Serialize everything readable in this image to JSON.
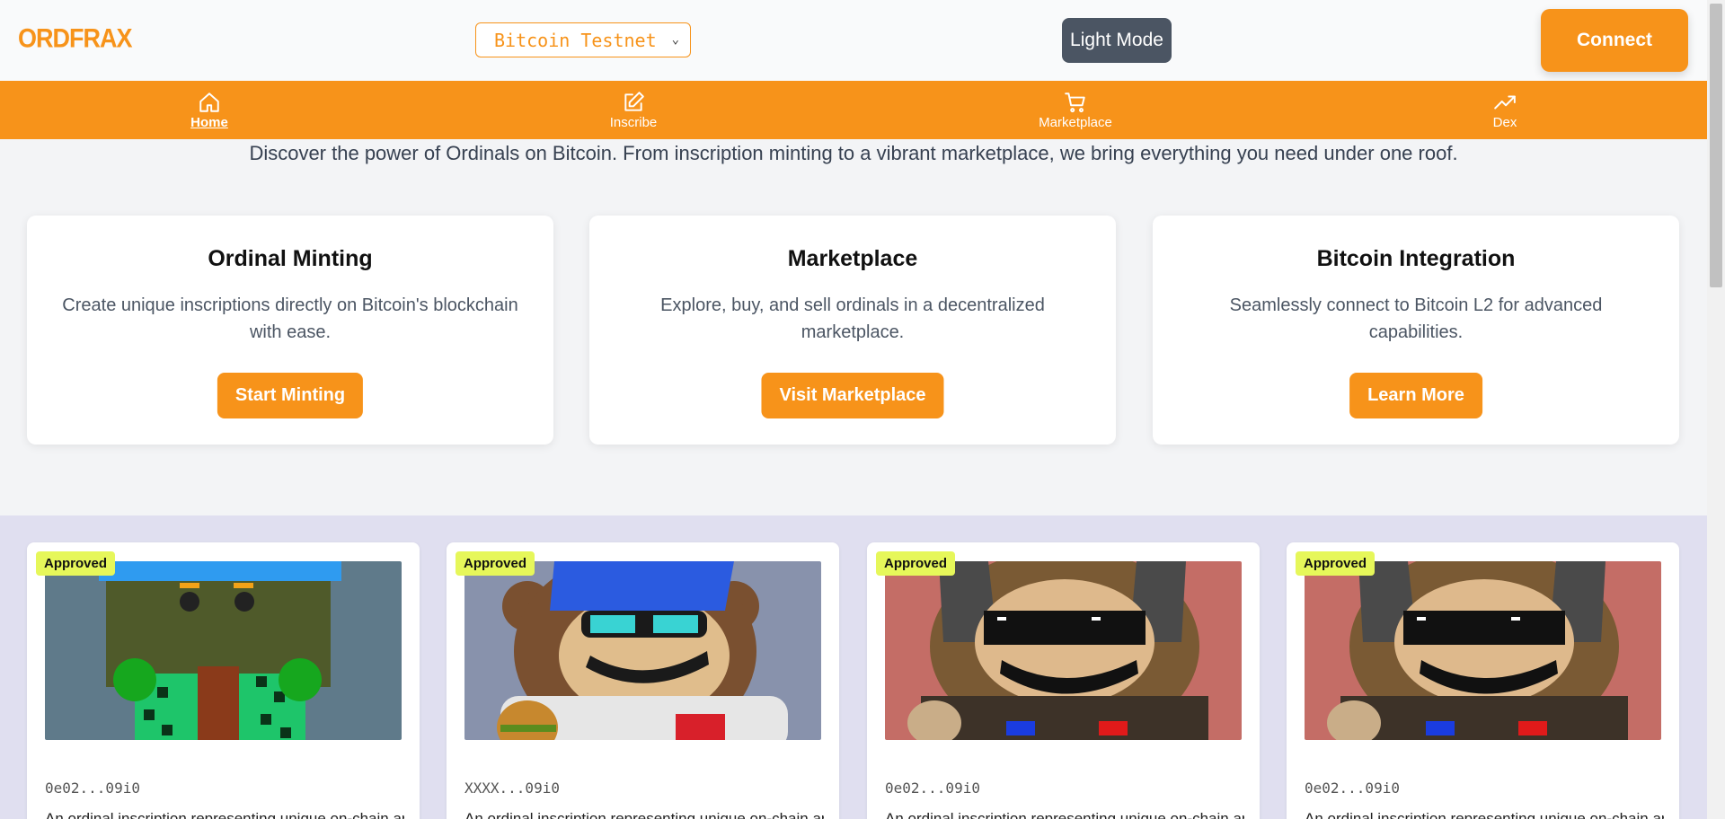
{
  "header": {
    "logo": "ORDFRAX",
    "network_select": "Bitcoin Testnet",
    "theme_toggle": "Light Mode",
    "connect_label": "Connect"
  },
  "nav": {
    "items": [
      {
        "label": "Home",
        "icon": "home-icon",
        "active": true
      },
      {
        "label": "Inscribe",
        "icon": "edit-icon",
        "active": false
      },
      {
        "label": "Marketplace",
        "icon": "cart-icon",
        "active": false
      },
      {
        "label": "Dex",
        "icon": "trend-icon",
        "active": false
      }
    ]
  },
  "intro": "Discover the power of Ordinals on Bitcoin. From inscription minting to a vibrant marketplace, we bring everything you need under one roof.",
  "features": [
    {
      "title": "Ordinal Minting",
      "desc": "Create unique inscriptions directly on Bitcoin's blockchain with ease.",
      "button": "Start Minting"
    },
    {
      "title": "Marketplace",
      "desc": "Explore, buy, and sell ordinals in a decentralized marketplace.",
      "button": "Visit Marketplace"
    },
    {
      "title": "Bitcoin Integration",
      "desc": "Seamlessly connect to Bitcoin L2 for advanced capabilities.",
      "button": "Learn More"
    }
  ],
  "items": [
    {
      "badge": "Approved",
      "id": "0e02...09i0",
      "desc": "An ordinal inscription representing unique on-chain art"
    },
    {
      "badge": "Approved",
      "id": "XXXX...09i0",
      "desc": "An ordinal inscription representing unique on-chain art"
    },
    {
      "badge": "Approved",
      "id": "0e02...09i0",
      "desc": "An ordinal inscription representing unique on-chain art"
    },
    {
      "badge": "Approved",
      "id": "0e02...09i0",
      "desc": "An ordinal inscription representing unique on-chain art"
    }
  ],
  "colors": {
    "brand": "#f7931a",
    "badge": "#e6f75a",
    "gallery_bg": "#e0dff0"
  }
}
